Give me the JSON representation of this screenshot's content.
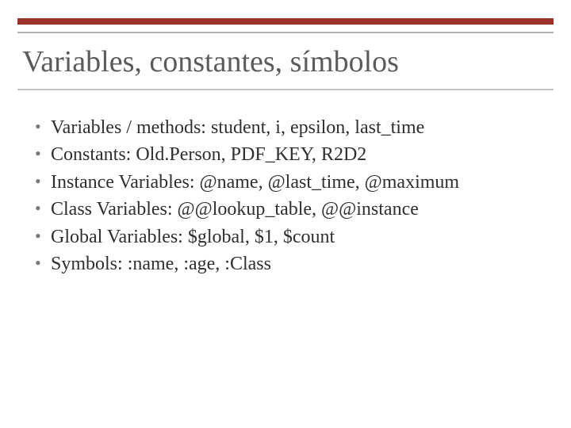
{
  "title": "Variables, constantes, símbolos",
  "bullets": [
    "Variables / methods: student, i, epsilon, last_time",
    "Constants: Old.Person, PDF_KEY, R2D2",
    "Instance Variables: @name, @last_time, @maximum",
    "Class Variables: @@lookup_table, @@instance",
    "Global Variables: $global, $1, $count",
    "Symbols: :name, :age, :Class"
  ],
  "colors": {
    "accent": "#9c3128",
    "rule": "#b0b0b0",
    "titleText": "#5b5b5b",
    "bodyText": "#2f2f2f"
  }
}
